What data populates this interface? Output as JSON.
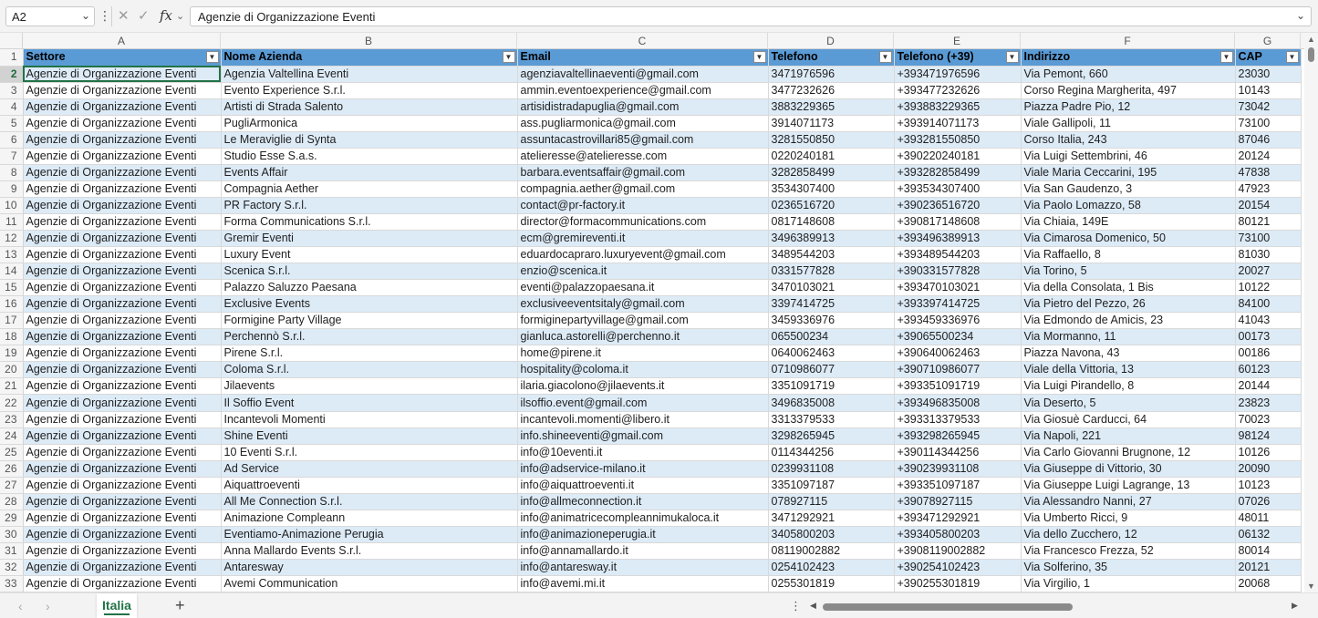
{
  "formula_bar": {
    "name_box": "A2",
    "formula": "Agenzie di Organizzazione Eventi"
  },
  "columns": [
    "A",
    "B",
    "C",
    "D",
    "E",
    "F",
    "G"
  ],
  "headers": [
    "Settore",
    "Nome Azienda",
    "Email",
    "Telefono",
    "Telefono (+39)",
    "Indirizzo",
    "CAP"
  ],
  "rows": [
    [
      "Agenzie di Organizzazione Eventi",
      "Agenzia Valtellina Eventi",
      "agenziavaltellinaeventi@gmail.com",
      "3471976596",
      "+393471976596",
      "Via Pemont, 660",
      "23030"
    ],
    [
      "Agenzie di Organizzazione Eventi",
      "Evento Experience S.r.l.",
      "ammin.eventoexperience@gmail.com",
      "3477232626",
      "+393477232626",
      "Corso Regina Margherita, 497",
      "10143"
    ],
    [
      "Agenzie di Organizzazione Eventi",
      "Artisti di Strada Salento",
      "artisidistradapuglia@gmail.com",
      "3883229365",
      "+393883229365",
      "Piazza Padre Pio, 12",
      "73042"
    ],
    [
      "Agenzie di Organizzazione Eventi",
      "PugliArmonica",
      "ass.pugliarmonica@gmail.com",
      "3914071173",
      "+393914071173",
      "Viale Gallipoli, 11",
      "73100"
    ],
    [
      "Agenzie di Organizzazione Eventi",
      "Le Meraviglie di Synta",
      "assuntacastrovillari85@gmail.com",
      "3281550850",
      "+393281550850",
      "Corso Italia, 243",
      "87046"
    ],
    [
      "Agenzie di Organizzazione Eventi",
      "Studio Esse S.a.s.",
      "atelieresse@atelieresse.com",
      "0220240181",
      "+390220240181",
      "Via Luigi Settembrini, 46",
      "20124"
    ],
    [
      "Agenzie di Organizzazione Eventi",
      "Events Affair",
      "barbara.eventsaffair@gmail.com",
      "3282858499",
      "+393282858499",
      "Viale Maria Ceccarini, 195",
      "47838"
    ],
    [
      "Agenzie di Organizzazione Eventi",
      "Compagnia Aether",
      "compagnia.aether@gmail.com",
      "3534307400",
      "+393534307400",
      "Via San Gaudenzo, 3",
      "47923"
    ],
    [
      "Agenzie di Organizzazione Eventi",
      "PR Factory S.r.l.",
      "contact@pr-factory.it",
      "0236516720",
      "+390236516720",
      "Via Paolo Lomazzo, 58",
      "20154"
    ],
    [
      "Agenzie di Organizzazione Eventi",
      "Forma Communications S.r.l.",
      "director@formacommunications.com",
      "0817148608",
      "+390817148608",
      "Via Chiaia, 149E",
      "80121"
    ],
    [
      "Agenzie di Organizzazione Eventi",
      "Gremir Eventi",
      "ecm@gremireventi.it",
      "3496389913",
      "+393496389913",
      "Via Cimarosa Domenico, 50",
      "73100"
    ],
    [
      "Agenzie di Organizzazione Eventi",
      "Luxury Event",
      "eduardocapraro.luxuryevent@gmail.com",
      "3489544203",
      "+393489544203",
      "Via Raffaello, 8",
      "81030"
    ],
    [
      "Agenzie di Organizzazione Eventi",
      "Scenica S.r.l.",
      "enzio@scenica.it",
      "0331577828",
      "+390331577828",
      "Via Torino, 5",
      "20027"
    ],
    [
      "Agenzie di Organizzazione Eventi",
      "Palazzo Saluzzo Paesana",
      "eventi@palazzopaesana.it",
      "3470103021",
      "+393470103021",
      "Via della Consolata, 1 Bis",
      "10122"
    ],
    [
      "Agenzie di Organizzazione Eventi",
      "Exclusive Events",
      "exclusiveeventsitaly@gmail.com",
      "3397414725",
      "+393397414725",
      "Via Pietro del Pezzo, 26",
      "84100"
    ],
    [
      "Agenzie di Organizzazione Eventi",
      "Formigine Party Village",
      "formiginepartyvillage@gmail.com",
      "3459336976",
      "+393459336976",
      "Via Edmondo de Amicis, 23",
      "41043"
    ],
    [
      "Agenzie di Organizzazione Eventi",
      "Perchennò S.r.l.",
      "gianluca.astorelli@perchenno.it",
      "065500234",
      "+39065500234",
      "Via Mormanno, 11",
      "00173"
    ],
    [
      "Agenzie di Organizzazione Eventi",
      "Pirene S.r.l.",
      "home@pirene.it",
      "0640062463",
      "+390640062463",
      "Piazza Navona, 43",
      "00186"
    ],
    [
      "Agenzie di Organizzazione Eventi",
      "Coloma S.r.l.",
      "hospitality@coloma.it",
      "0710986077",
      "+390710986077",
      "Viale della Vittoria, 13",
      "60123"
    ],
    [
      "Agenzie di Organizzazione Eventi",
      "Jilaevents",
      "ilaria.giacolono@jilaevents.it",
      "3351091719",
      "+393351091719",
      "Via Luigi Pirandello, 8",
      "20144"
    ],
    [
      "Agenzie di Organizzazione Eventi",
      "Il Soffio Event",
      "ilsoffio.event@gmail.com",
      "3496835008",
      "+393496835008",
      "Via Deserto, 5",
      "23823"
    ],
    [
      "Agenzie di Organizzazione Eventi",
      "Incantevoli Momenti",
      "incantevoli.momenti@libero.it",
      "3313379533",
      "+393313379533",
      "Via Giosuè Carducci, 64",
      "70023"
    ],
    [
      "Agenzie di Organizzazione Eventi",
      "Shine Eventi",
      "info.shineeventi@gmail.com",
      "3298265945",
      "+393298265945",
      "Via Napoli, 221",
      "98124"
    ],
    [
      "Agenzie di Organizzazione Eventi",
      "10 Eventi S.r.l.",
      "info@10eventi.it",
      "0114344256",
      "+390114344256",
      "Via Carlo Giovanni Brugnone, 12",
      "10126"
    ],
    [
      "Agenzie di Organizzazione Eventi",
      "Ad Service",
      "info@adservice-milano.it",
      "0239931108",
      "+390239931108",
      "Via Giuseppe di Vittorio, 30",
      "20090"
    ],
    [
      "Agenzie di Organizzazione Eventi",
      "Aiquattroeventi",
      "info@aiquattroeventi.it",
      "3351097187",
      "+393351097187",
      "Via Giuseppe Luigi Lagrange, 13",
      "10123"
    ],
    [
      "Agenzie di Organizzazione Eventi",
      "All Me Connection S.r.l.",
      "info@allmeconnection.it",
      "078927115",
      "+39078927115",
      "Via Alessandro Nanni, 27",
      "07026"
    ],
    [
      "Agenzie di Organizzazione Eventi",
      "Animazione Compleann",
      "info@animatricecompleannimukaloca.it",
      "3471292921",
      "+393471292921",
      "Via Umberto Ricci, 9",
      "48011"
    ],
    [
      "Agenzie di Organizzazione Eventi",
      "Eventiamo-Animazione Perugia",
      "info@animazioneperugia.it",
      "3405800203",
      "+393405800203",
      "Via dello Zucchero, 12",
      "06132"
    ],
    [
      "Agenzie di Organizzazione Eventi",
      "Anna Mallardo Events S.r.l.",
      "info@annamallardo.it",
      "08119002882",
      "+3908119002882",
      "Via Francesco Frezza, 52",
      "80014"
    ],
    [
      "Agenzie di Organizzazione Eventi",
      "Antaresway",
      "info@antaresway.it",
      "0254102423",
      "+390254102423",
      "Via Solferino, 35",
      "20121"
    ],
    [
      "Agenzie di Organizzazione Eventi",
      "Avemi Communication",
      "info@avemi.mi.it",
      "0255301819",
      "+390255301819",
      "Via Virgilio, 1",
      "20068"
    ]
  ],
  "sheet_tab": "Italia",
  "icons": {
    "cancel": "close-icon",
    "enter": "check-icon",
    "fx": "function-icon",
    "add_sheet": "plus-icon"
  },
  "colors": {
    "header_fill": "#5b9bd5",
    "band_fill": "#ddebf7",
    "accent": "#217346"
  }
}
